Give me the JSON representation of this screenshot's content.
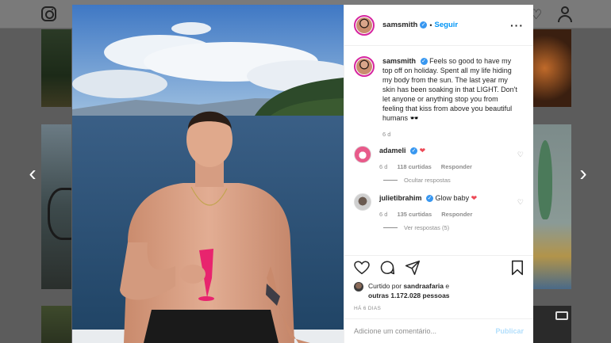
{
  "post": {
    "author": "samsmith",
    "follow_label": "Seguir",
    "dot": "•",
    "caption": "Feels so good to have my top off on holiday. Spent all my life hiding my body from the sun. The last year my skin has been soaking in that LIGHT. Don't let anyone or anything stop you from feeling that kiss from above you beautiful humans 🕶️",
    "caption_time": "6 d",
    "liked_by_prefix": "Curtido por",
    "liked_by_user": "sandraafaria",
    "liked_by_and": "e",
    "liked_by_others": "outras 1.172.028 pessoas",
    "age": "HÁ 6 DIAS"
  },
  "comments": [
    {
      "user": "adameli",
      "text": "❤",
      "time": "6 d",
      "likes": "118 curtidas",
      "reply_label": "Responder",
      "replies_label": "Ocultar respostas"
    },
    {
      "user": "julietibrahim",
      "text": "Glow baby",
      "time": "6 d",
      "likes": "135 curtidas",
      "reply_label": "Responder",
      "replies_label": "Ver respostas (5)"
    }
  ],
  "composer": {
    "placeholder": "Adicione um comentário...",
    "publish_label": "Publicar"
  },
  "icons": {
    "top_left": "instagram-icon",
    "nav_prev": "chevron-left-icon",
    "nav_next": "chevron-right-icon",
    "options": "more-icon",
    "like": "heart-icon",
    "comment": "comment-icon",
    "share": "send-icon",
    "save": "bookmark-icon",
    "verified": "verified-badge-icon"
  },
  "colors": {
    "accent": "#0095f6",
    "verified": "#3897f0",
    "heart": "#ed4956",
    "muted": "#8e8e8e"
  }
}
